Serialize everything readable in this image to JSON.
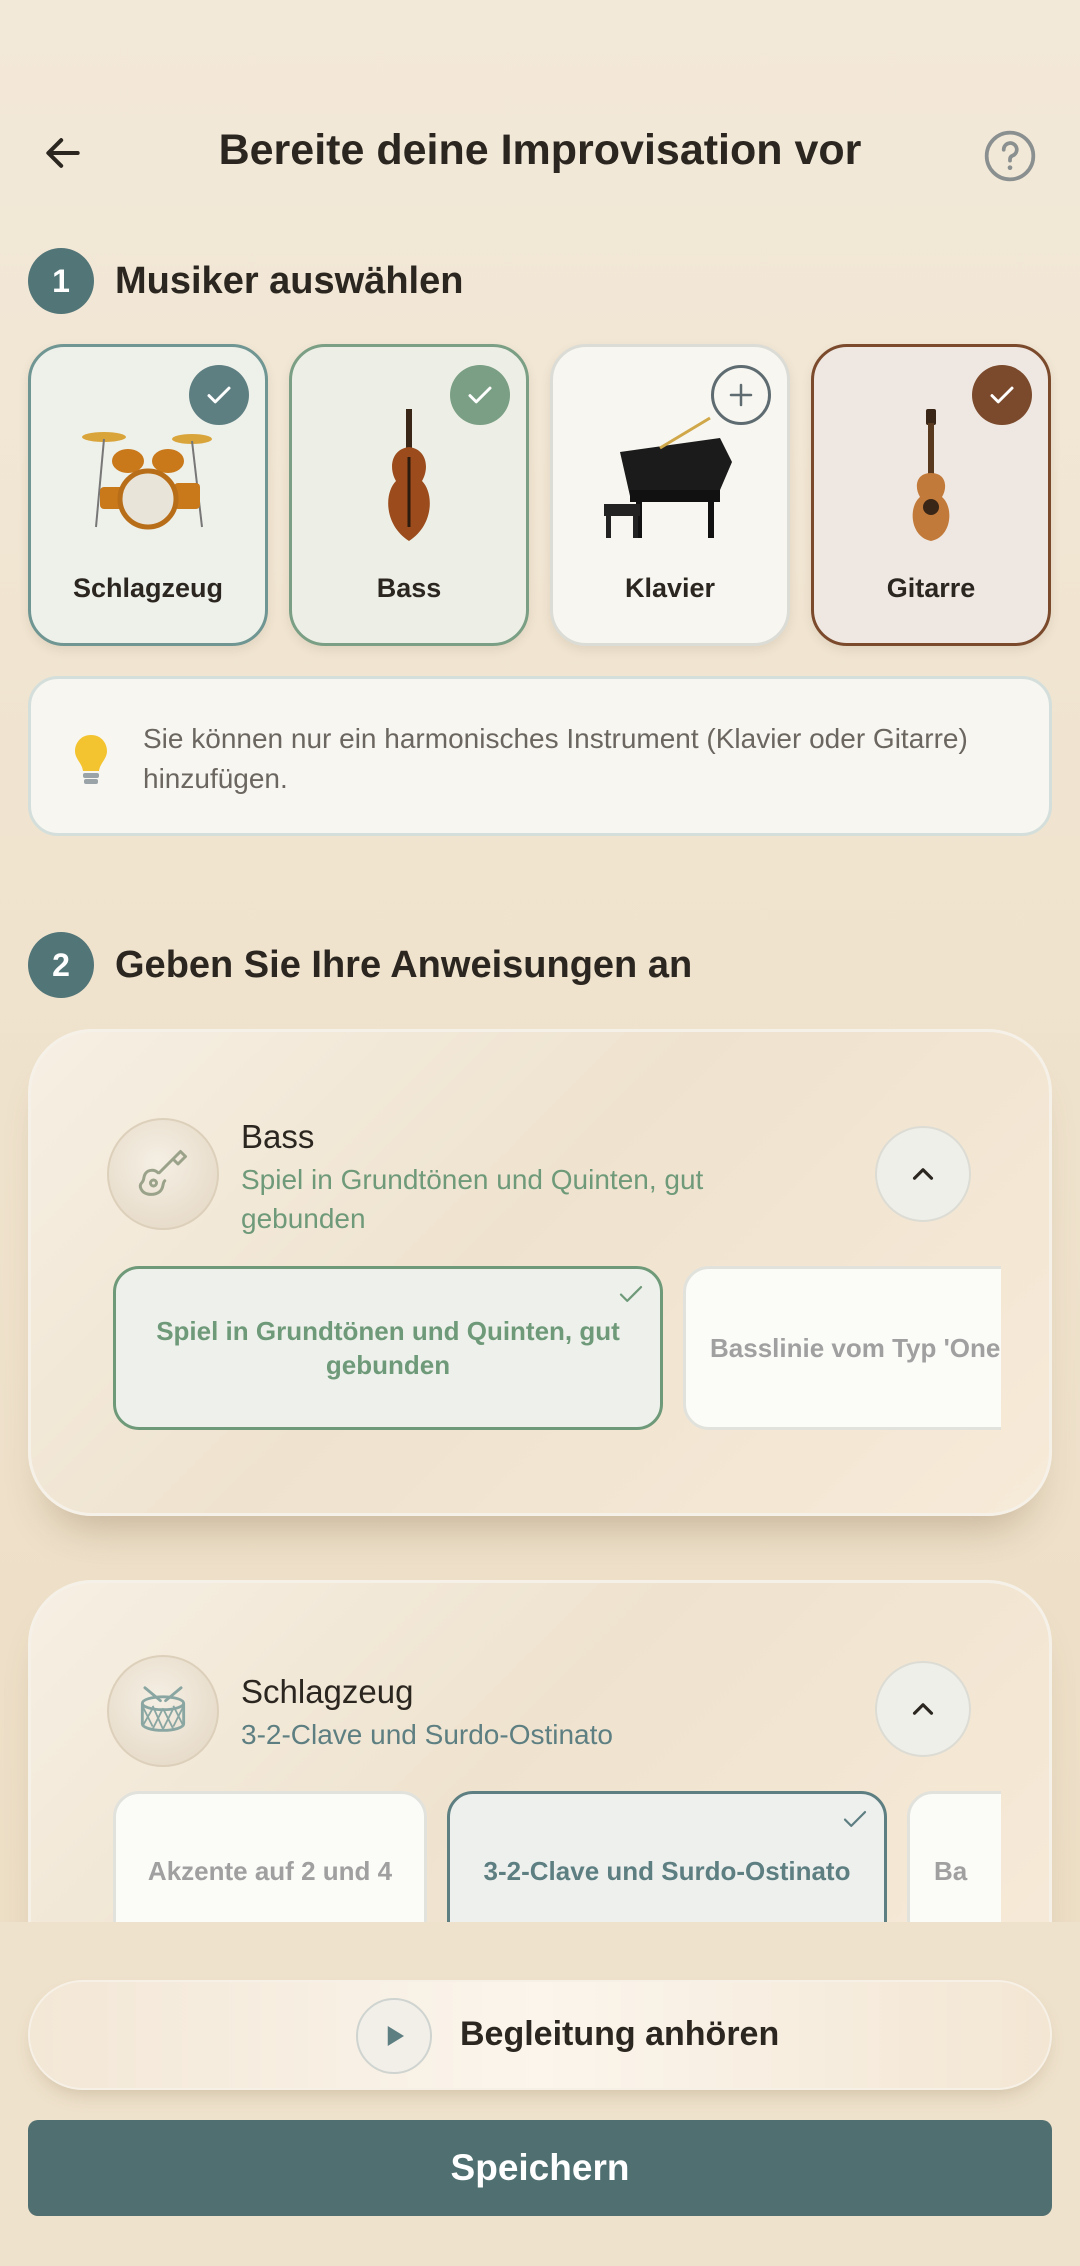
{
  "header": {
    "title": "Bereite deine Improvisation vor",
    "back_icon": "arrow-left-icon",
    "help_icon": "help-circle-icon"
  },
  "step1": {
    "number": "1",
    "title": "Musiker auswählen",
    "musicians": [
      {
        "label": "Schlagzeug",
        "state": "selected",
        "icon": "drum-kit-icon",
        "check_color": "#5e7f82"
      },
      {
        "label": "Bass",
        "state": "selected",
        "icon": "double-bass-icon",
        "check_color": "#7a9f84"
      },
      {
        "label": "Klavier",
        "state": "add",
        "icon": "grand-piano-icon",
        "check_color": "#5e6b70"
      },
      {
        "label": "Gitarre",
        "state": "selected",
        "icon": "acoustic-guitar-icon",
        "check_color": "#7b4a2c"
      }
    ],
    "info": {
      "icon": "lightbulb-icon",
      "text": "Sie können nur ein harmonisches Instrument (Klavier oder Gitarre) hinzufügen."
    }
  },
  "step2": {
    "number": "2",
    "title": "Geben Sie Ihre Anweisungen an",
    "panels": [
      {
        "name": "Bass",
        "subtitle": "Spiel in Grundtönen und Quinten, gut gebunden",
        "subtitle_color": "#6f9a7a",
        "icon": "guitar-icon",
        "options": [
          "Spiel in Grundtönen und Quinten, gut gebunden",
          "Basslinie vom Typ 'One"
        ],
        "selected_index": 0
      },
      {
        "name": "Schlagzeug",
        "subtitle": "3-2-Clave und Surdo-Ostinato",
        "subtitle_color": "#5e7f82",
        "icon": "drum-icon",
        "options": [
          "Akzente auf 2 und 4",
          "3-2-Clave und Surdo-Ostinato",
          "Ba"
        ],
        "selected_index": 1
      }
    ]
  },
  "footer": {
    "listen_label": "Begleitung anhören",
    "play_icon": "play-icon",
    "save_label": "Speichern"
  }
}
